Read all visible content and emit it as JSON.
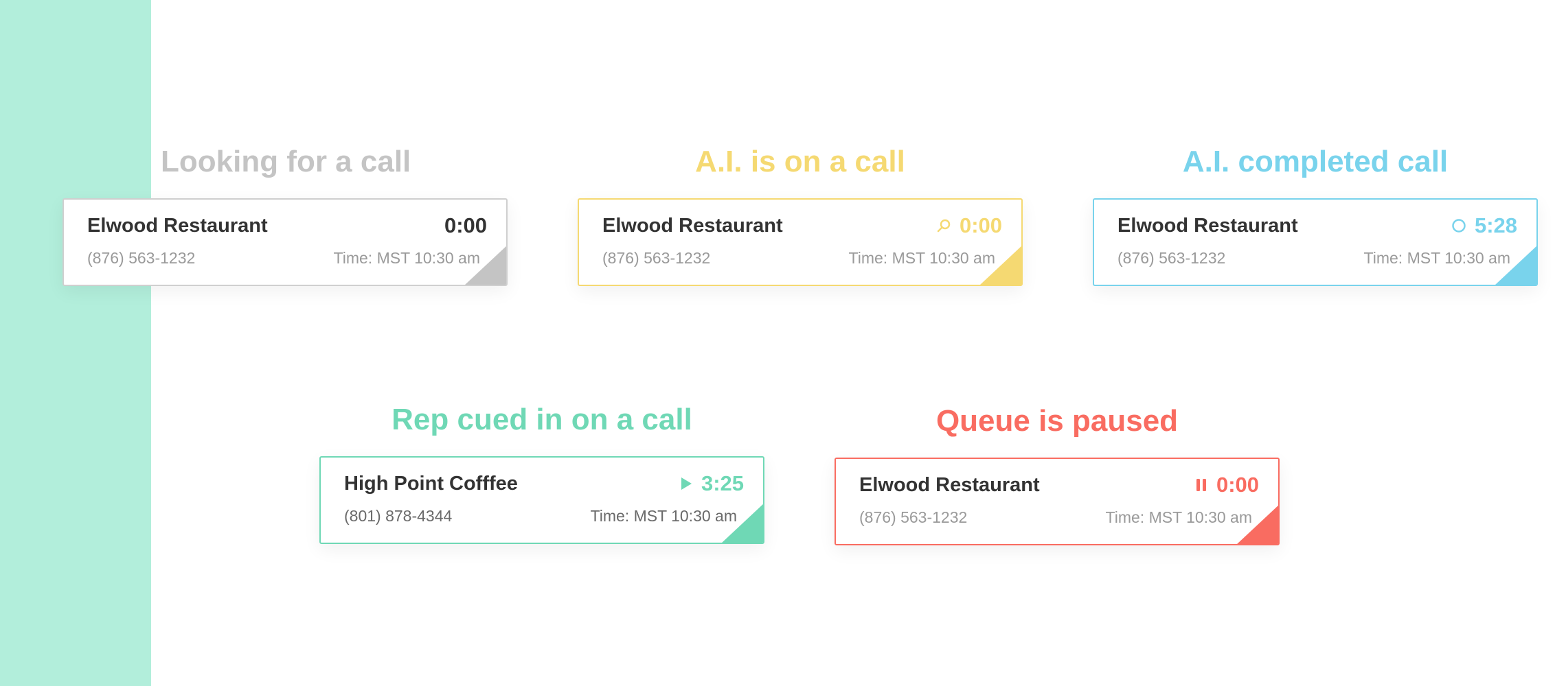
{
  "colors": {
    "sidebar": "#b2eedb",
    "idle": "#c4c4c4",
    "in_call": "#f5d972",
    "completed": "#79d3ec",
    "rep": "#6fd8b5",
    "paused": "#f96c61",
    "text_dark": "#333333",
    "text_muted": "#9a9a9a"
  },
  "states": [
    {
      "title": "Looking for a call",
      "icon": "none",
      "card": {
        "name": "Elwood Restaurant",
        "timer": "0:00",
        "phone": "(876) 563-1232",
        "time": "Time: MST 10:30 am"
      }
    },
    {
      "title": "A.I. is on a call",
      "icon": "search-icon",
      "card": {
        "name": "Elwood Restaurant",
        "timer": "0:00",
        "phone": "(876) 563-1232",
        "time": "Time: MST 10:30 am"
      }
    },
    {
      "title": "A.I. completed call",
      "icon": "circle-icon",
      "card": {
        "name": "Elwood Restaurant",
        "timer": "5:28",
        "phone": "(876) 563-1232",
        "time": "Time: MST 10:30 am"
      }
    },
    {
      "title": "Rep cued in on a call",
      "icon": "play-icon",
      "card": {
        "name": "High Point Cofffee",
        "timer": "3:25",
        "phone": "(801) 878-4344",
        "time": "Time: MST 10:30 am"
      }
    },
    {
      "title": "Queue is paused",
      "icon": "pause-icon",
      "card": {
        "name": "Elwood Restaurant",
        "timer": "0:00",
        "phone": "(876) 563-1232",
        "time": "Time: MST 10:30 am"
      }
    }
  ]
}
